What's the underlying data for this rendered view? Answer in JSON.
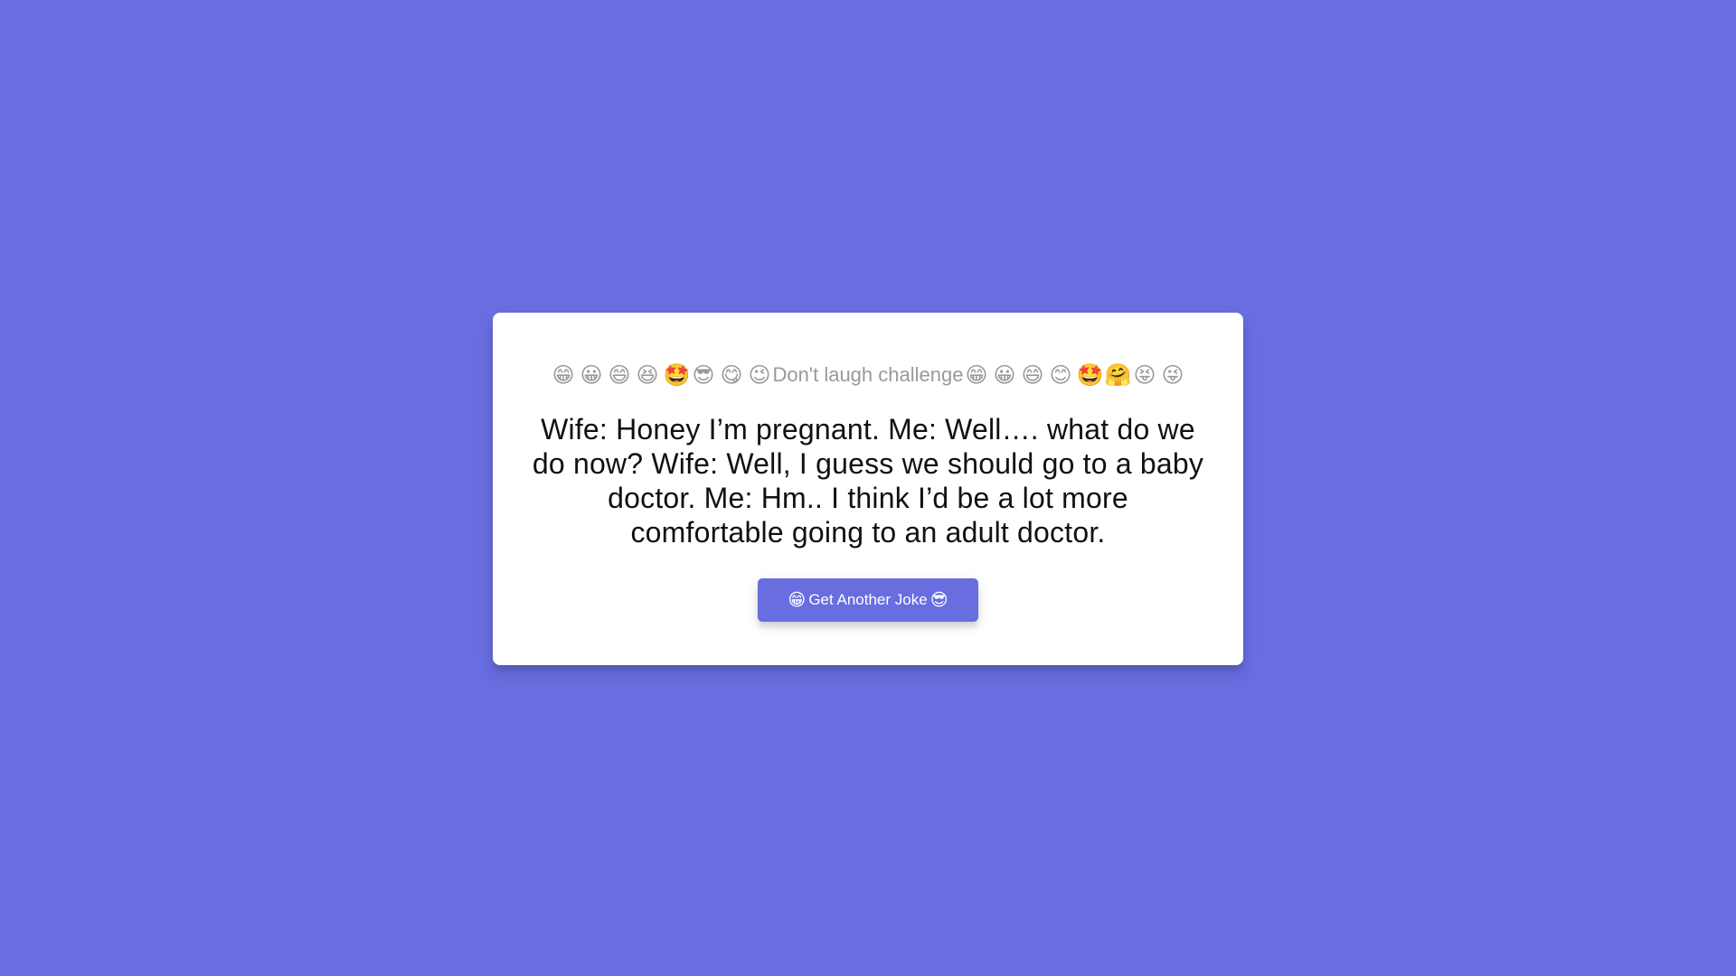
{
  "page": {
    "background_color": "#686de0"
  },
  "card": {
    "heading": {
      "emojis_left": [
        "😁",
        "😀",
        "😄",
        "😆",
        "🤩",
        "😎",
        "😋",
        "😉"
      ],
      "text": "Don't laugh challenge",
      "emojis_right": [
        "😁",
        "😀",
        "😄",
        "😊",
        "🤩",
        "🤗",
        "😝",
        "😜"
      ]
    },
    "joke": "Wife: Honey I’m pregnant. Me: Well…. what do we do now? Wife: Well, I guess we should go to a baby doctor. Me: Hm.. I think I’d be a lot more comfortable going to an adult doctor.",
    "button": {
      "emoji_left": "😁",
      "label": "Get Another Joke",
      "emoji_right": "😎",
      "color": "#686de0"
    }
  }
}
